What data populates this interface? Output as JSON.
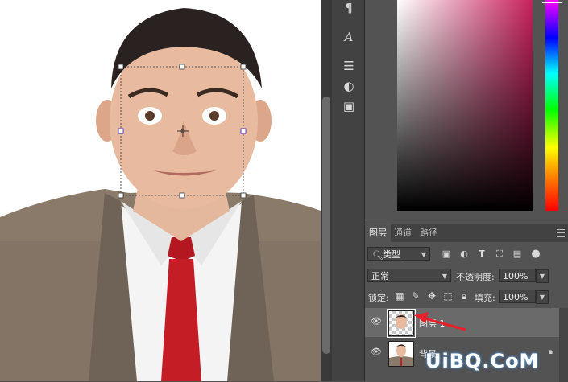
{
  "tools": [
    {
      "name": "paragraph-icon",
      "glyph": "¶"
    },
    {
      "name": "character-icon",
      "glyph": "A"
    },
    {
      "name": "adjustments-icon",
      "glyph": "☰"
    },
    {
      "name": "styles-icon",
      "glyph": "◐"
    },
    {
      "name": "libraries-icon",
      "glyph": "▣"
    }
  ],
  "layers_panel": {
    "tabs": [
      "图层",
      "通道",
      "路径"
    ],
    "filter": {
      "value": "类型"
    },
    "blend_mode": "正常",
    "opacity_label": "不透明度:",
    "opacity_value": "100%",
    "lock_label": "锁定:",
    "fill_label": "填充:",
    "fill_value": "100%",
    "layers": [
      {
        "name": "图层 1",
        "selected": true
      },
      {
        "name": "背景",
        "selected": false
      }
    ]
  },
  "colors": {
    "accent": "#c8215c",
    "panel": "#535353",
    "arrow": "#e8202a"
  },
  "watermark": "UiBQ.CoM"
}
